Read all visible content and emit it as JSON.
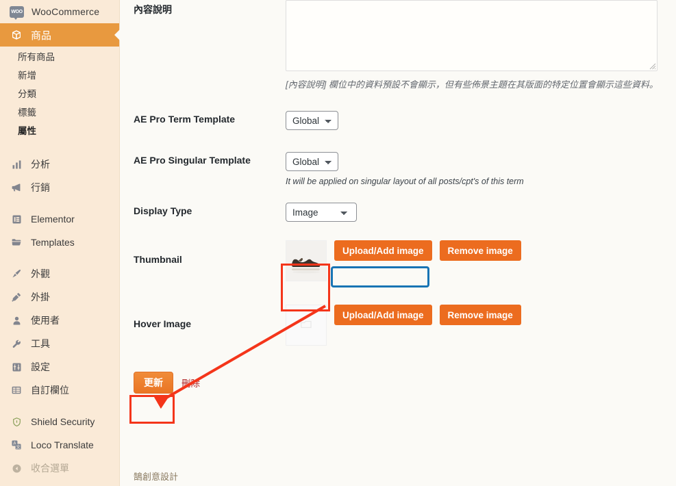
{
  "sidebar": {
    "top_item": {
      "label": "WooCommerce",
      "icon": "woo-icon",
      "badge_text": "WOO"
    },
    "active_item": {
      "label": "商品",
      "icon": "product-box-icon"
    },
    "submenu": [
      {
        "label": "所有商品",
        "current": false
      },
      {
        "label": "新增",
        "current": false
      },
      {
        "label": "分類",
        "current": false
      },
      {
        "label": "標籤",
        "current": false
      },
      {
        "label": "屬性",
        "current": true
      }
    ],
    "groups": [
      [
        {
          "label": "分析",
          "icon": "chart-bar-icon",
          "dim": false
        },
        {
          "label": "行銷",
          "icon": "megaphone-icon",
          "dim": false
        }
      ],
      [
        {
          "label": "Elementor",
          "icon": "elementor-icon",
          "dim": false
        },
        {
          "label": "Templates",
          "icon": "folder-icon",
          "dim": false
        }
      ],
      [
        {
          "label": "外觀",
          "icon": "paintbrush-icon",
          "dim": false
        },
        {
          "label": "外掛",
          "icon": "plug-icon",
          "dim": false
        },
        {
          "label": "使用者",
          "icon": "user-icon",
          "dim": false
        },
        {
          "label": "工具",
          "icon": "wrench-icon",
          "dim": false
        },
        {
          "label": "設定",
          "icon": "settings-sliders-icon",
          "dim": false
        },
        {
          "label": "自訂欄位",
          "icon": "custom-fields-icon",
          "dim": false
        }
      ],
      [
        {
          "label": "Shield Security",
          "icon": "shield-icon",
          "dim": false
        },
        {
          "label": "Loco Translate",
          "icon": "translate-icon",
          "dim": false
        },
        {
          "label": "收合選單",
          "icon": "collapse-arrow-icon",
          "dim": true
        }
      ]
    ]
  },
  "form": {
    "description": {
      "label": "內容說明",
      "value": "",
      "placeholder": "",
      "help": "[內容說明] 欄位中的資料預設不會顯示，但有些佈景主題在其版面的特定位置會顯示這些資料。"
    },
    "ae_pro_term_template": {
      "label": "AE Pro Term Template",
      "value": "Global",
      "options": [
        "Global"
      ]
    },
    "ae_pro_singular_template": {
      "label": "AE Pro Singular Template",
      "value": "Global",
      "options": [
        "Global"
      ],
      "help": "It will be applied on singular layout of all posts/cpt's of this term"
    },
    "display_type": {
      "label": "Display Type",
      "value": "Image",
      "options": [
        "Image"
      ]
    },
    "thumbnail": {
      "label": "Thumbnail",
      "upload_label": "Upload/Add image",
      "remove_label": "Remove image",
      "has_image": true
    },
    "hover_image": {
      "label": "Hover Image",
      "upload_label": "Upload/Add image",
      "remove_label": "Remove image",
      "has_image": false
    }
  },
  "actions": {
    "update_label": "更新",
    "delete_label": "刪除"
  },
  "footer": {
    "credit": "鵠創意設計"
  },
  "colors": {
    "sidebar_bg": "#faead7",
    "active_menu": "#e8993f",
    "button_orange": "#ec6c1f",
    "annotation_red": "#f4351a",
    "annotation_blue": "#1874b4",
    "page_bg": "#fbfaf6"
  }
}
